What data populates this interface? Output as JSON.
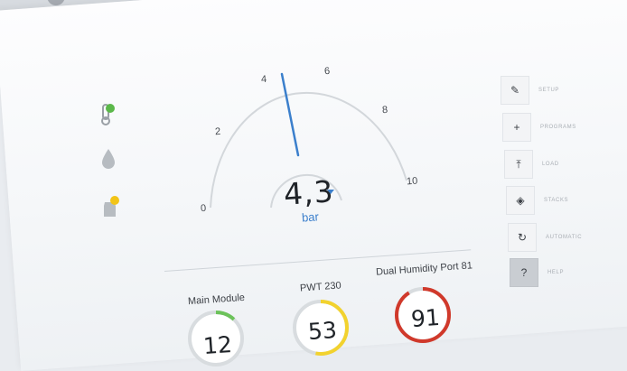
{
  "gauge": {
    "value": "4,3",
    "unit": "bar",
    "reading": 4.3,
    "scale_min": 0,
    "scale_max": 10,
    "ticks": [
      "0",
      "2",
      "4",
      "6",
      "8",
      "10"
    ],
    "needle_color": "#3b7fcc"
  },
  "status_icons": [
    {
      "name": "thermometer-icon",
      "indicator_color": "#5bb84a"
    },
    {
      "name": "drop-icon"
    },
    {
      "name": "tank-icon",
      "indicator_color": "#f2c417"
    }
  ],
  "modules": [
    {
      "title": "Main Module",
      "value": "12",
      "ring_color": "#6cc25a",
      "level": 0.12
    },
    {
      "title": "PWT 230",
      "value": "53",
      "ring_color": "#f2d22e",
      "level": 0.53
    },
    {
      "title": "Dual Humidity Port 81",
      "value": "91",
      "ring_color": "#d0392b",
      "level": 0.91
    }
  ],
  "menu": [
    {
      "label": "SETUP",
      "icon": "wrench-icon",
      "glyph": "✎"
    },
    {
      "label": "PROGRAMS",
      "icon": "plus-icon",
      "glyph": "+"
    },
    {
      "label": "LOAD",
      "icon": "upload-icon",
      "glyph": "⤒"
    },
    {
      "label": "STACKS",
      "icon": "layers-icon",
      "glyph": "◈"
    },
    {
      "label": "AUTOMATIC",
      "icon": "refresh-icon",
      "glyph": "↻"
    },
    {
      "label": "HELP",
      "icon": "help-icon",
      "glyph": "?"
    }
  ]
}
